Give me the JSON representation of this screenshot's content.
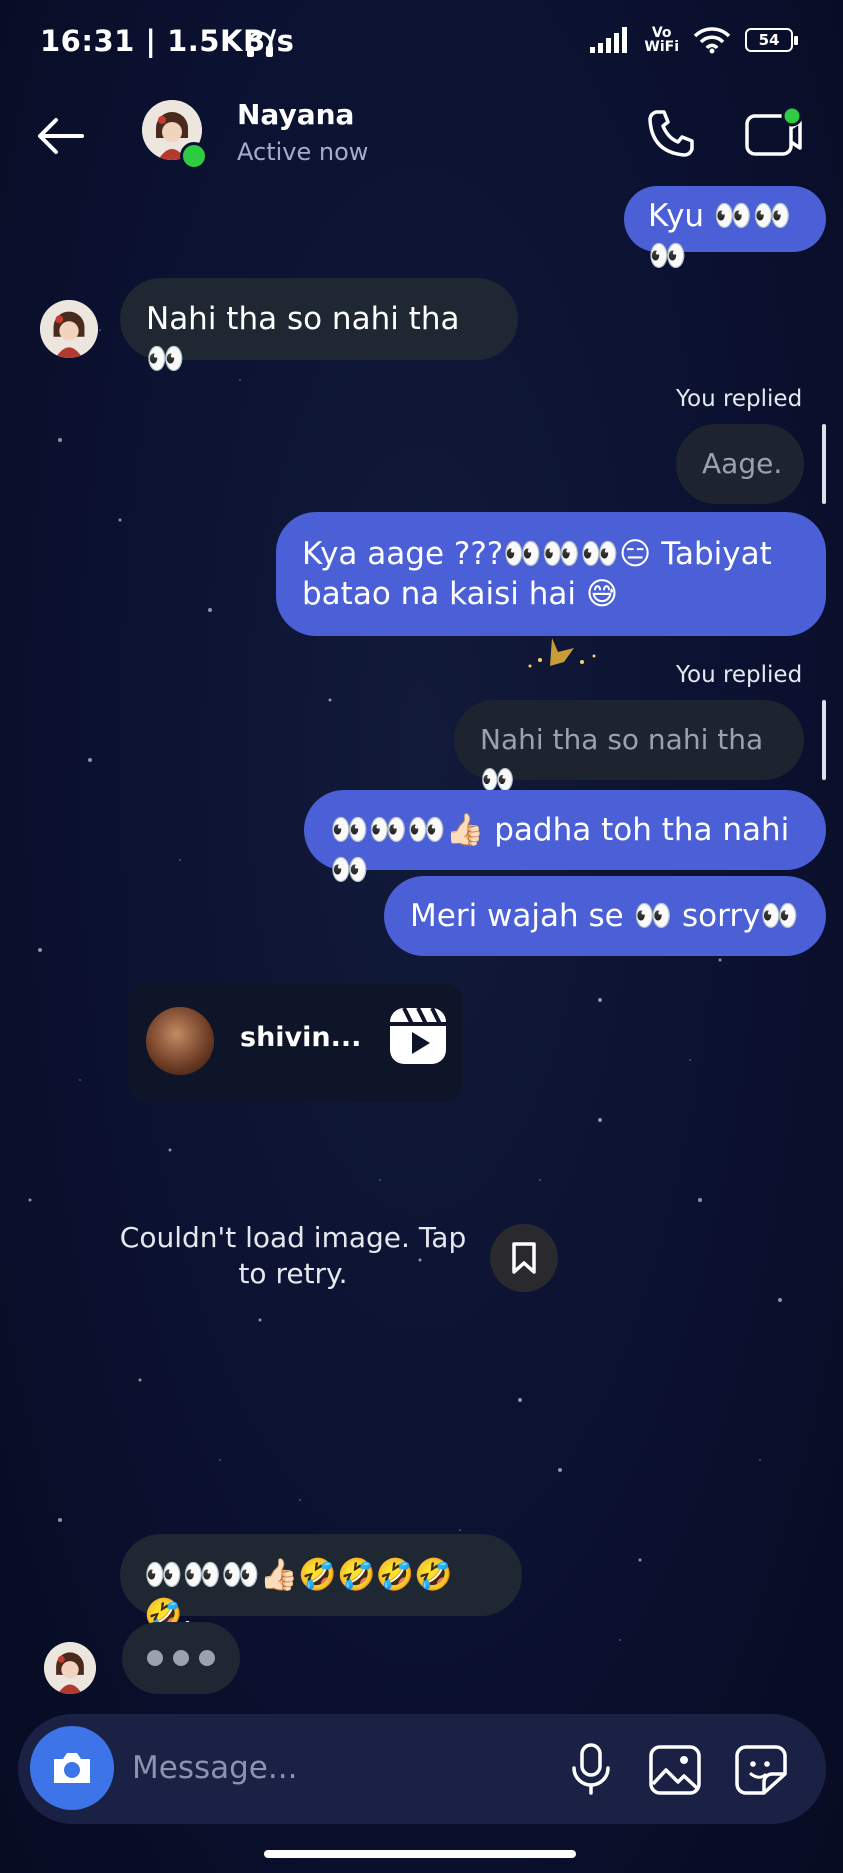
{
  "status_bar": {
    "time_speed": "16:31 | 1.5KB/s",
    "network_label_top": "Vo",
    "network_label_bottom": "WiFi",
    "battery": "54"
  },
  "header": {
    "name": "Nayana",
    "status": "Active now"
  },
  "messages": [
    {
      "type": "outgoing",
      "text": "Kyu 👀👀👀"
    },
    {
      "type": "incoming",
      "text": "Nahi tha so nahi tha👀"
    },
    {
      "type": "reply_label",
      "text": "You replied"
    },
    {
      "type": "quoted",
      "text": "Aage."
    },
    {
      "type": "outgoing",
      "text": "Kya aage ???👀👀👀😑 Tabiyat batao na kaisi hai 😅"
    },
    {
      "type": "reply_label",
      "text": "You replied"
    },
    {
      "type": "quoted",
      "text": "Nahi tha so nahi tha👀"
    },
    {
      "type": "outgoing",
      "text": "👀👀👀👍🏻 padha toh tha nahi 👀"
    },
    {
      "type": "outgoing",
      "text": "Meri wajah se 👀 sorry👀"
    },
    {
      "type": "incoming",
      "text": "👀👀👀👍🏻🤣🤣🤣🤣🤣."
    }
  ],
  "reel": {
    "username": "shivin...",
    "error_text": "Couldn't load image. Tap to retry."
  },
  "composer": {
    "placeholder": "Message..."
  },
  "colors": {
    "outgoing_bubble": "#4b5fd6",
    "incoming_bubble": "#1f2732",
    "online": "#2ecc40",
    "camera_button": "#3d74e8"
  },
  "icons": [
    "back-arrow-icon",
    "phone-icon",
    "video-call-icon",
    "reel-icon",
    "bookmark-icon",
    "camera-icon",
    "mic-icon",
    "gallery-icon",
    "sticker-icon"
  ]
}
